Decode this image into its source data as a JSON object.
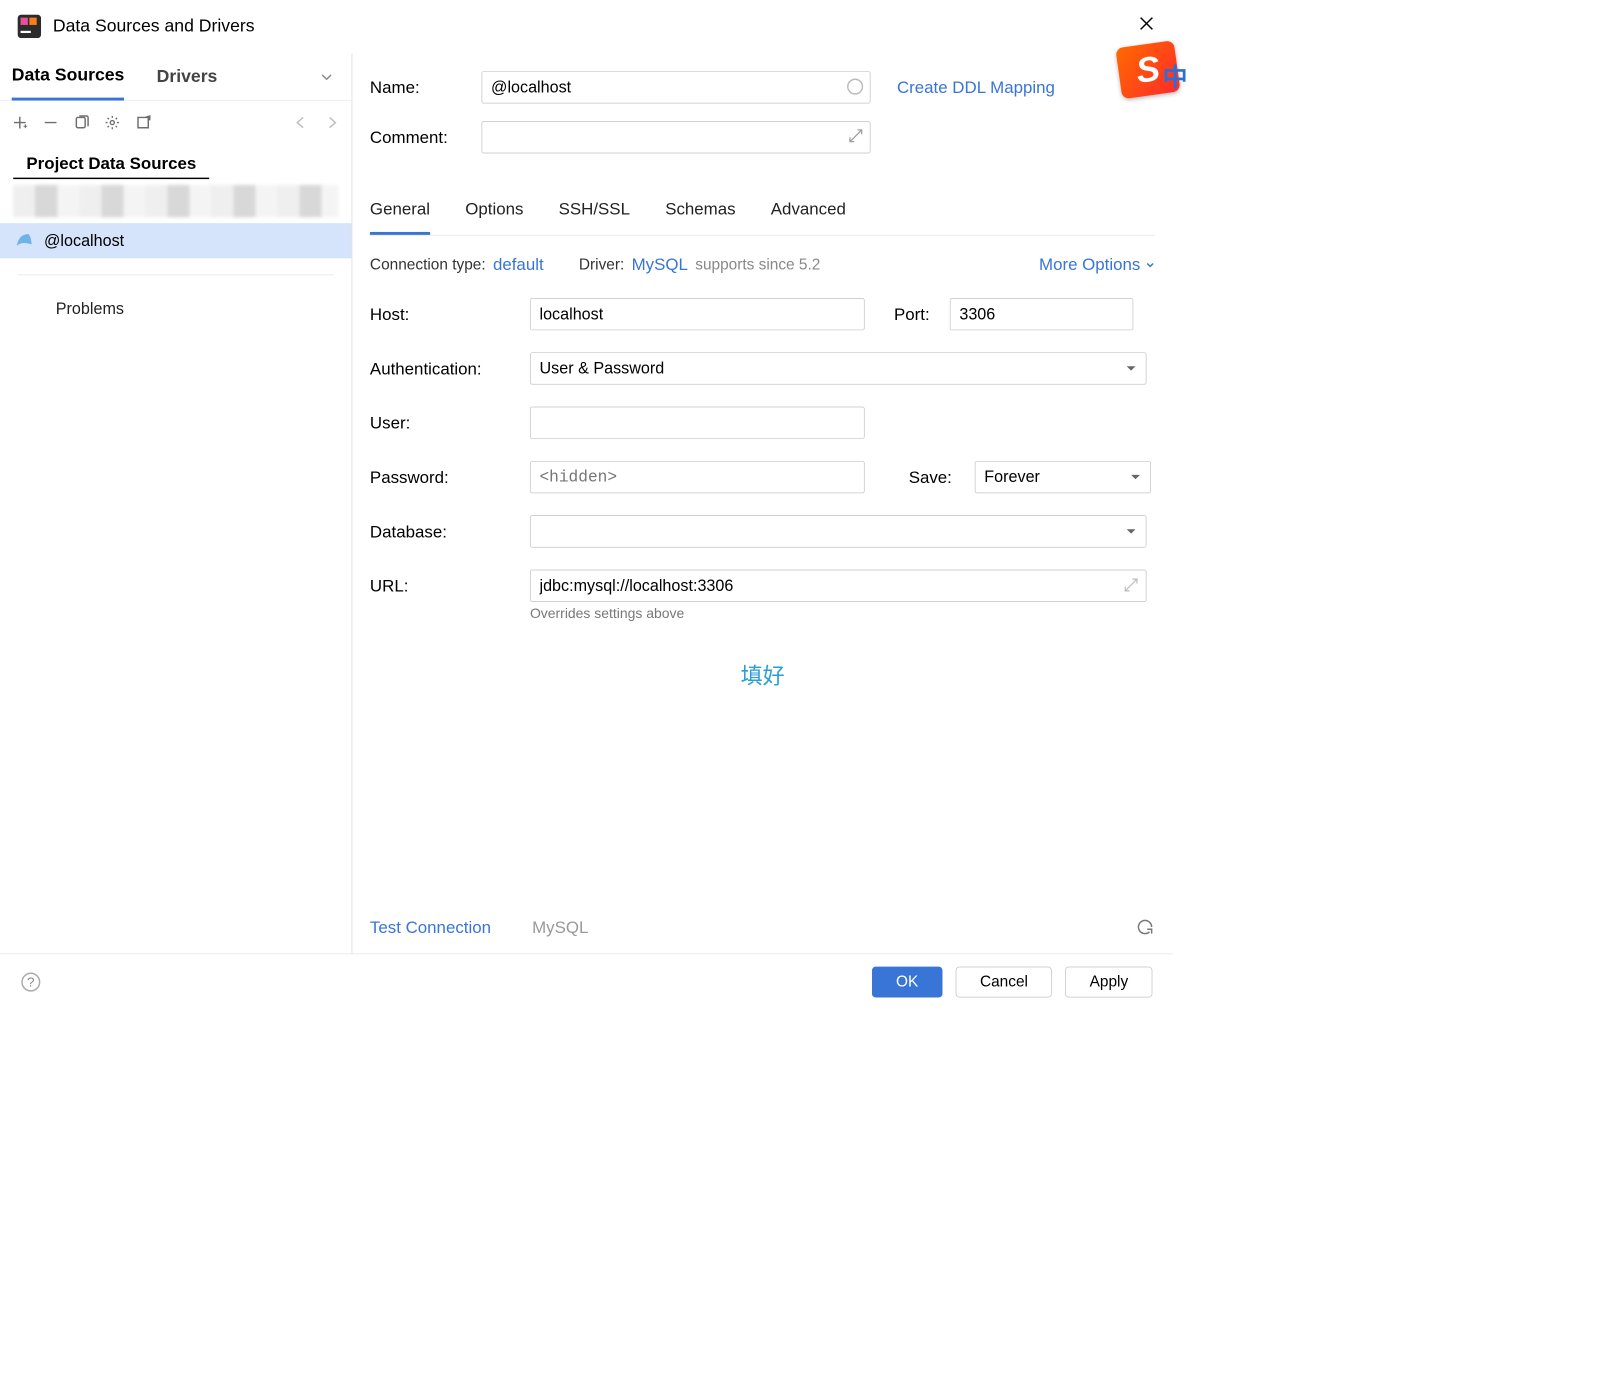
{
  "title": "Data Sources and Drivers",
  "leftTabs": {
    "dataSources": "Data Sources",
    "drivers": "Drivers"
  },
  "sectionLabel": "Project Data Sources",
  "treeSelected": "@localhost",
  "problems": "Problems",
  "labels": {
    "name": "Name:",
    "comment": "Comment:",
    "createDDL": "Create DDL Mapping",
    "connType": "Connection type:",
    "connTypeVal": "default",
    "driverLbl": "Driver:",
    "driverVal": "MySQL",
    "supports": "supports since 5.2",
    "moreOptions": "More Options",
    "host": "Host:",
    "port": "Port:",
    "auth": "Authentication:",
    "user": "User:",
    "password": "Password:",
    "save": "Save:",
    "database": "Database:",
    "url": "URL:",
    "overrideHint": "Overrides settings above",
    "testConn": "Test Connection",
    "driverName": "MySQL"
  },
  "nameValue": "@localhost",
  "tabs": [
    "General",
    "Options",
    "SSH/SSL",
    "Schemas",
    "Advanced"
  ],
  "hostValue": "localhost",
  "portValue": "3306",
  "authValue": "User & Password",
  "userValue": "",
  "passwordPlaceholder": "<hidden>",
  "saveValue": "Forever",
  "databaseValue": "",
  "urlValue": "jdbc:mysql://localhost:3306",
  "annotation": "填好",
  "buttons": {
    "ok": "OK",
    "cancel": "Cancel",
    "apply": "Apply"
  },
  "ime": "S",
  "imeZh": "中"
}
